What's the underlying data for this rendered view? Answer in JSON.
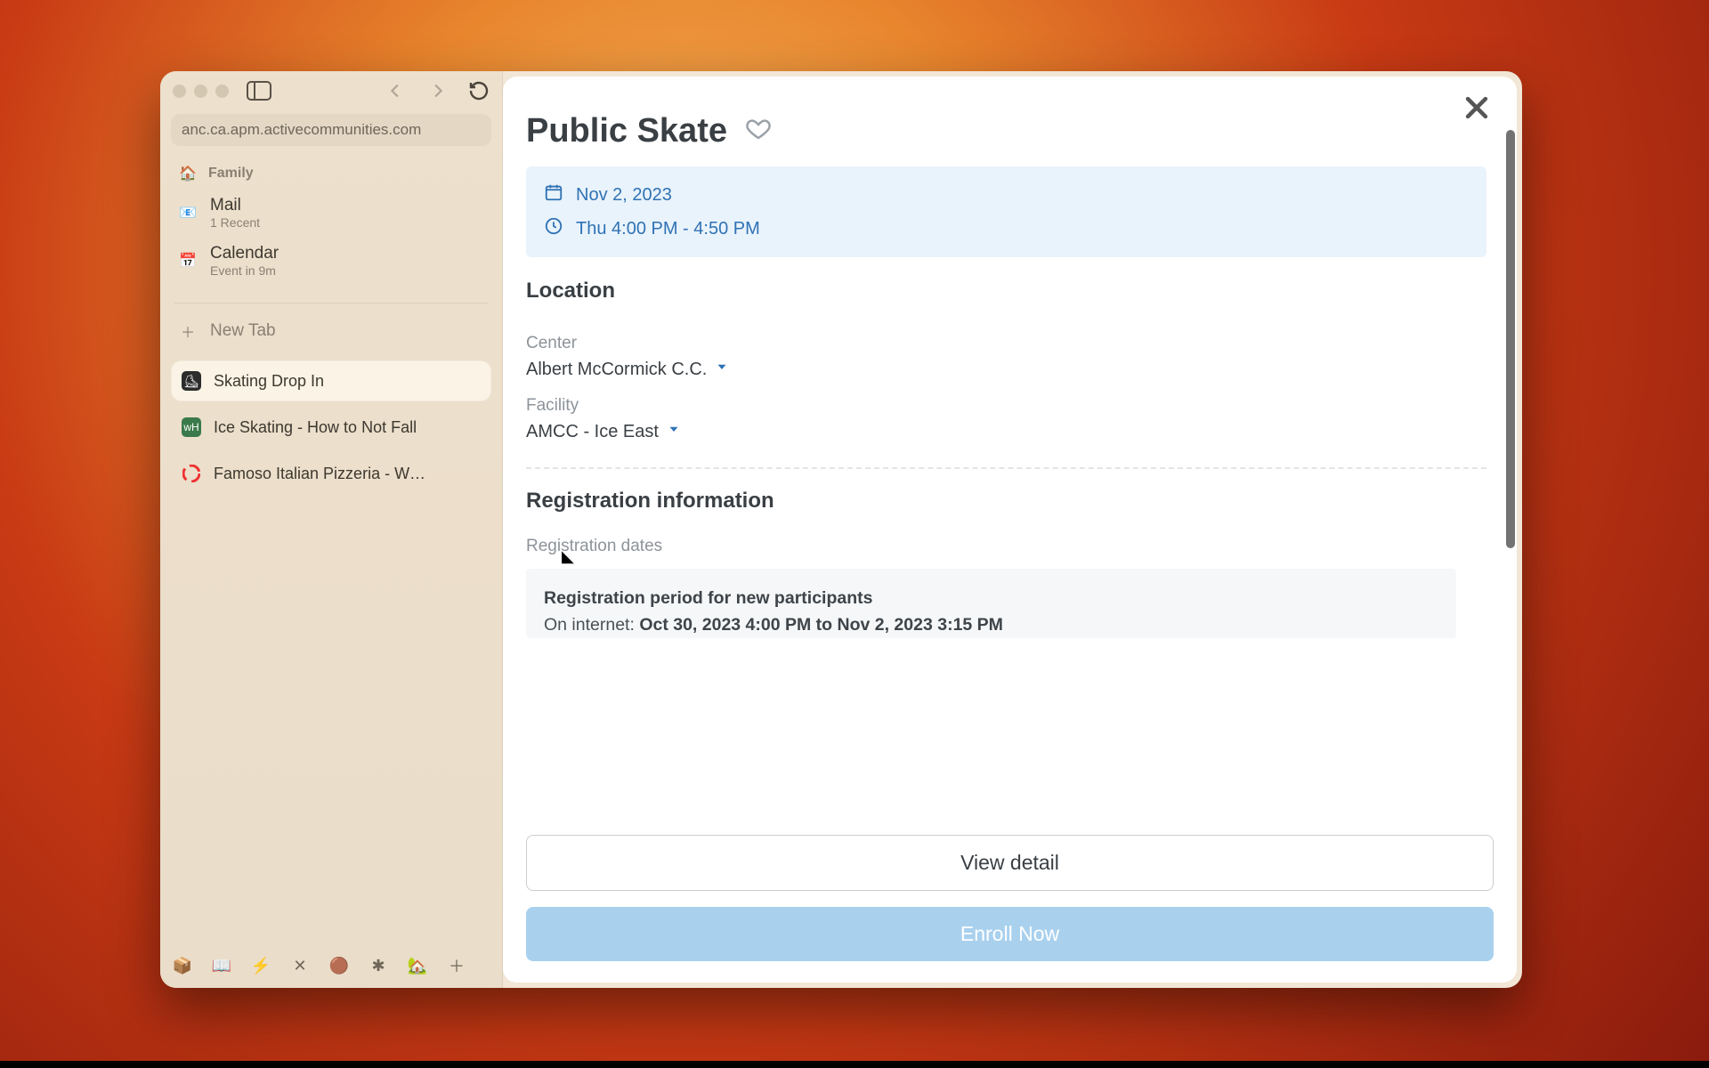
{
  "browser": {
    "url": "anc.ca.apm.activecommunities.com",
    "pinned": {
      "heading": "Family",
      "mail": {
        "title": "Mail",
        "sub": "1 Recent"
      },
      "calendar": {
        "title": "Calendar",
        "sub": "Event in 9m"
      }
    },
    "newTab": "New Tab",
    "tabs": [
      {
        "label": "Skating Drop In"
      },
      {
        "label": "Ice Skating - How to Not Fall"
      },
      {
        "label": "Famoso Italian Pizzeria - W…"
      }
    ]
  },
  "page": {
    "title": "Public Skate",
    "date": "Nov 2, 2023",
    "time": "Thu 4:00 PM - 4:50 PM",
    "location_h": "Location",
    "center_label": "Center",
    "center_value": "Albert McCormick C.C.",
    "facility_label": "Facility",
    "facility_value": "AMCC - Ice East",
    "reg_h": "Registration information",
    "reg_dates_label": "Registration dates",
    "reg_box": {
      "heading": "Registration period for new participants",
      "line1_label": "On internet: ",
      "line1_value": "Oct 30, 2023 4:00 PM to Nov 2, 2023 3:15 PM"
    },
    "actions": {
      "view": "View detail",
      "enroll": "Enroll Now"
    }
  }
}
